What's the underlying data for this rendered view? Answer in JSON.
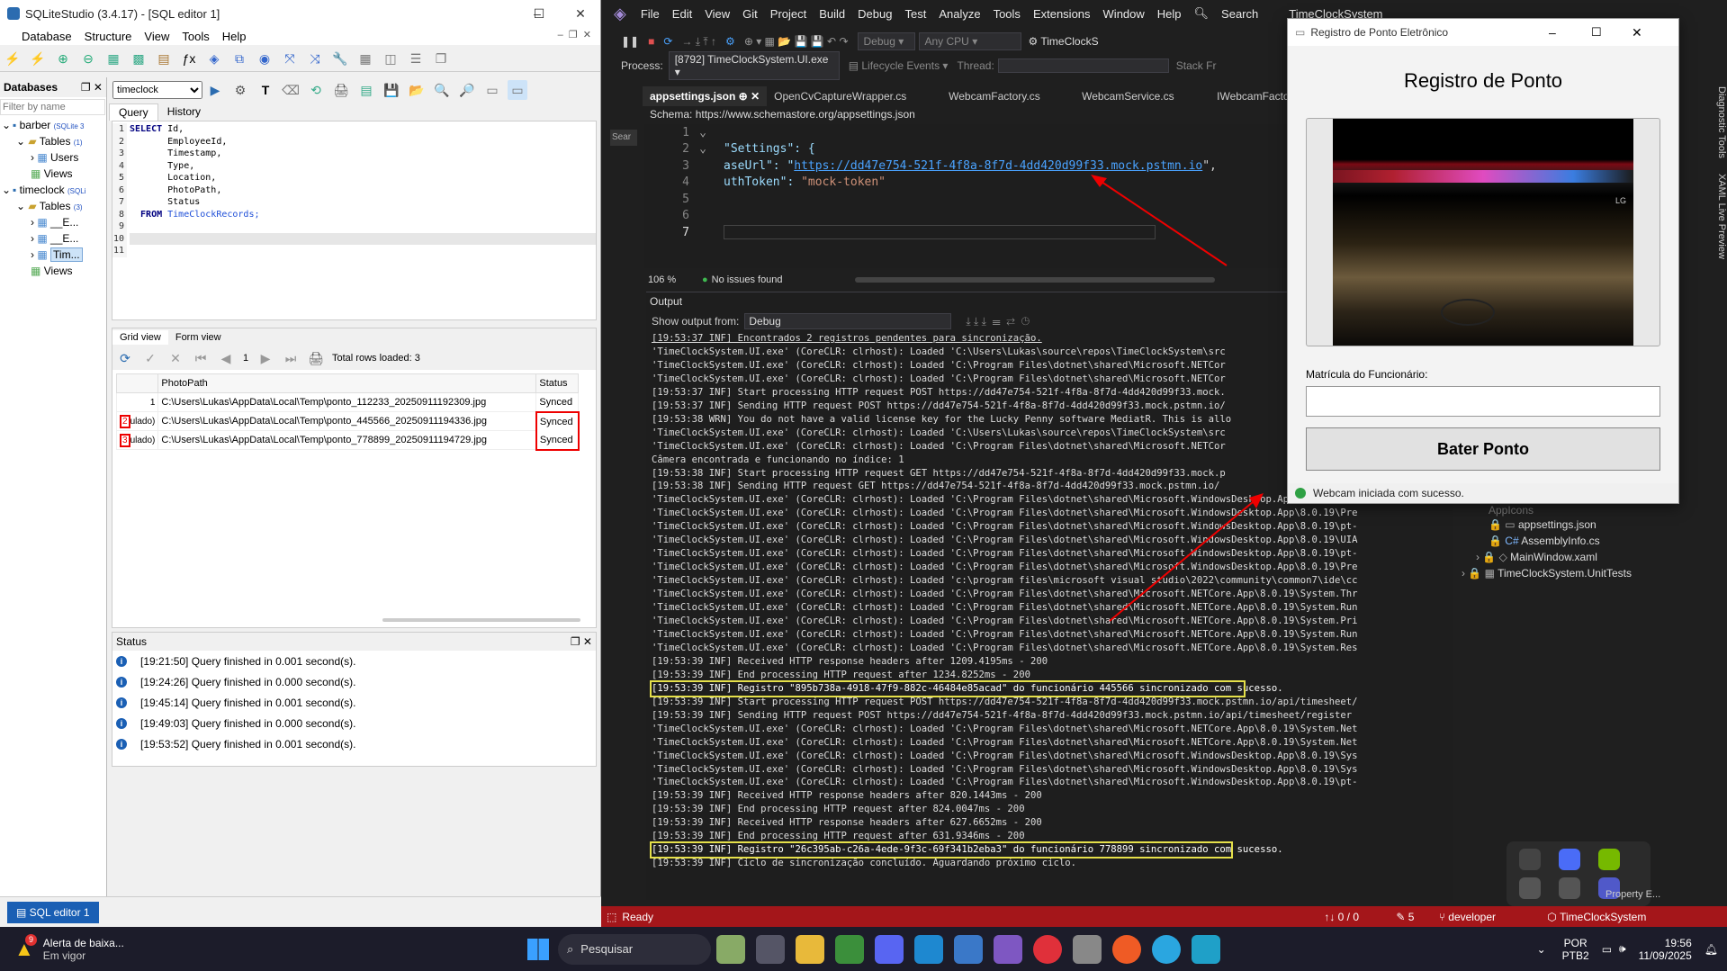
{
  "sqlite": {
    "title": "SQLiteStudio (3.4.17) - [SQL editor 1]",
    "menu": [
      "Database",
      "Structure",
      "View",
      "Tools",
      "Help"
    ],
    "db_panel_title": "Databases",
    "filter_placeholder": "Filter by name",
    "tree": [
      {
        "label": "barber",
        "tag": "(SQLite 3"
      },
      {
        "label": "Tables",
        "tag": "(1)"
      },
      {
        "label": "Users",
        "tag": ""
      },
      {
        "label": "Views",
        "tag": ""
      },
      {
        "label": "timeclock",
        "tag": "(SQLi"
      },
      {
        "label": "Tables",
        "tag": "(3)"
      },
      {
        "label": "__E...",
        "tag": ""
      },
      {
        "label": "__E...",
        "tag": ""
      },
      {
        "label": "Tim...",
        "tag": ""
      },
      {
        "label": "Views",
        "tag": ""
      }
    ],
    "db_select": "timeclock",
    "tabs": [
      "Query",
      "History"
    ],
    "sql_lines": [
      {
        "n": "1",
        "kw": "SELECT",
        "rest": " Id,"
      },
      {
        "n": "2",
        "kw": "",
        "rest": "       EmployeeId,"
      },
      {
        "n": "3",
        "kw": "",
        "rest": "       Timestamp,"
      },
      {
        "n": "4",
        "kw": "",
        "rest": "       Type,"
      },
      {
        "n": "5",
        "kw": "",
        "rest": "       Location,"
      },
      {
        "n": "6",
        "kw": "",
        "rest": "       PhotoPath,"
      },
      {
        "n": "7",
        "kw": "",
        "rest": "       Status"
      },
      {
        "n": "8",
        "kw": "  FROM",
        "rest": " TimeClockRecords;"
      },
      {
        "n": "9",
        "kw": "",
        "rest": ""
      },
      {
        "n": "10",
        "kw": "",
        "rest": ""
      },
      {
        "n": "11",
        "kw": "",
        "rest": ""
      }
    ],
    "result_tabs": [
      "Grid view",
      "Form view"
    ],
    "page_num": "1",
    "total_rows": "Total rows loaded: 3",
    "columns": [
      "PhotoPath",
      "Status"
    ],
    "rows": [
      {
        "n": "1",
        "prefix": "",
        "path": "C:\\Users\\Lukas\\AppData\\Local\\Temp\\ponto_112233_20250911192309.jpg",
        "status": "Synced"
      },
      {
        "n": "2",
        "prefix": "ulado)",
        "path": "C:\\Users\\Lukas\\AppData\\Local\\Temp\\ponto_445566_20250911194336.jpg",
        "status": "Synced"
      },
      {
        "n": "3",
        "prefix": "ulado)",
        "path": "C:\\Users\\Lukas\\AppData\\Local\\Temp\\ponto_778899_20250911194729.jpg",
        "status": "Synced"
      }
    ],
    "status_title": "Status",
    "status_lines": [
      "[19:21:50] Query finished in 0.001 second(s).",
      "[19:24:26] Query finished in 0.000 second(s).",
      "[19:45:14] Query finished in 0.001 second(s).",
      "[19:49:03] Query finished in 0.000 second(s).",
      "[19:53:52] Query finished in 0.001 second(s)."
    ],
    "bottom_tab": "SQL editor 1"
  },
  "vs": {
    "menu": [
      "File",
      "Edit",
      "View",
      "Git",
      "Project",
      "Build",
      "Debug",
      "Test",
      "Analyze",
      "Tools",
      "Extensions",
      "Window",
      "Help"
    ],
    "search": "Search",
    "solution": "TimeClockSystem",
    "config": "Debug",
    "platform": "Any CPU",
    "process_label": "Process:",
    "process": "[8792] TimeClockSystem.UI.exe",
    "lifecycle": "Lifecycle Events",
    "thread": "Thread:",
    "stack": "Stack Fr",
    "run_target": "TimeClockS",
    "tabs": [
      "appsettings.json",
      "OpenCvCaptureWrapper.cs",
      "WebcamFactory.cs",
      "WebcamService.cs",
      "IWebcamFactor"
    ],
    "schema": "Schema: https://www.schemastore.org/appsettings.json",
    "code": [
      {
        "n": "1",
        "text": ""
      },
      {
        "n": "2",
        "text": "\"Settings\": {"
      },
      {
        "n": "3",
        "key": "aseUrl\": \"",
        "url": "https://dd47e754-521f-4f8a-8f7d-4dd420d99f33.mock.pstmn.io",
        "end": "\","
      },
      {
        "n": "4",
        "key": "uthToken\": ",
        "val": "\"mock-token\""
      },
      {
        "n": "5",
        "text": ""
      },
      {
        "n": "6",
        "text": ""
      },
      {
        "n": "7",
        "text": ""
      }
    ],
    "zoom": "106 %",
    "issues": "No issues found",
    "output_title": "Output",
    "show_output_label": "Show output from:",
    "show_output_value": "Debug",
    "output_lines": [
      "[19:53:37 INF] Encontrados 2 registros pendentes para sincronização.",
      "'TimeClockSystem.UI.exe' (CoreCLR: clrhost): Loaded 'C:\\Users\\Lukas\\source\\repos\\TimeClockSystem\\src",
      "'TimeClockSystem.UI.exe' (CoreCLR: clrhost): Loaded 'C:\\Program Files\\dotnet\\shared\\Microsoft.NETCor",
      "'TimeClockSystem.UI.exe' (CoreCLR: clrhost): Loaded 'C:\\Program Files\\dotnet\\shared\\Microsoft.NETCor",
      "[19:53:37 INF] Start processing HTTP request POST https://dd47e754-521f-4f8a-8f7d-4dd420d99f33.mock.",
      "[19:53:37 INF] Sending HTTP request POST https://dd47e754-521f-4f8a-8f7d-4dd420d99f33.mock.pstmn.io/",
      "[19:53:38 WRN] You do not have a valid license key for the Lucky Penny software MediatR. This is allo",
      "'TimeClockSystem.UI.exe' (CoreCLR: clrhost): Loaded 'C:\\Users\\Lukas\\source\\repos\\TimeClockSystem\\src",
      "'TimeClockSystem.UI.exe' (CoreCLR: clrhost): Loaded 'C:\\Program Files\\dotnet\\shared\\Microsoft.NETCor",
      "Câmera encontrada e funcionando no índice: 1",
      "[19:53:38 INF] Start processing HTTP request GET https://dd47e754-521f-4f8a-8f7d-4dd420d99f33.mock.p",
      "[19:53:38 INF] Sending HTTP request GET https://dd47e754-521f-4f8a-8f7d-4dd420d99f33.mock.pstmn.io/",
      "'TimeClockSystem.UI.exe' (CoreCLR: clrhost): Loaded 'C:\\Program Files\\dotnet\\shared\\Microsoft.WindowsDesktop.App\\8.0.19\\UIA",
      "'TimeClockSystem.UI.exe' (CoreCLR: clrhost): Loaded 'C:\\Program Files\\dotnet\\shared\\Microsoft.WindowsDesktop.App\\8.0.19\\Pre",
      "'TimeClockSystem.UI.exe' (CoreCLR: clrhost): Loaded 'C:\\Program Files\\dotnet\\shared\\Microsoft.WindowsDesktop.App\\8.0.19\\pt-",
      "'TimeClockSystem.UI.exe' (CoreCLR: clrhost): Loaded 'C:\\Program Files\\dotnet\\shared\\Microsoft.WindowsDesktop.App\\8.0.19\\UIA",
      "'TimeClockSystem.UI.exe' (CoreCLR: clrhost): Loaded 'C:\\Program Files\\dotnet\\shared\\Microsoft.WindowsDesktop.App\\8.0.19\\pt-",
      "'TimeClockSystem.UI.exe' (CoreCLR: clrhost): Loaded 'C:\\Program Files\\dotnet\\shared\\Microsoft.WindowsDesktop.App\\8.0.19\\Pre",
      "'TimeClockSystem.UI.exe' (CoreCLR: clrhost): Loaded 'c:\\program files\\microsoft visual studio\\2022\\community\\common7\\ide\\cc",
      "'TimeClockSystem.UI.exe' (CoreCLR: clrhost): Loaded 'C:\\Program Files\\dotnet\\shared\\Microsoft.NETCore.App\\8.0.19\\System.Thr",
      "'TimeClockSystem.UI.exe' (CoreCLR: clrhost): Loaded 'C:\\Program Files\\dotnet\\shared\\Microsoft.NETCore.App\\8.0.19\\System.Run",
      "'TimeClockSystem.UI.exe' (CoreCLR: clrhost): Loaded 'C:\\Program Files\\dotnet\\shared\\Microsoft.NETCore.App\\8.0.19\\System.Pri",
      "'TimeClockSystem.UI.exe' (CoreCLR: clrhost): Loaded 'C:\\Program Files\\dotnet\\shared\\Microsoft.NETCore.App\\8.0.19\\System.Run",
      "'TimeClockSystem.UI.exe' (CoreCLR: clrhost): Loaded 'C:\\Program Files\\dotnet\\shared\\Microsoft.NETCore.App\\8.0.19\\System.Res",
      "[19:53:39 INF] Received HTTP response headers after 1209.4195ms - 200",
      "[19:53:39 INF] End processing HTTP request after 1234.8252ms - 200",
      "[19:53:39 INF] Registro \"895b738a-4918-47f9-882c-46484e85acad\" do funcionário 445566 sincronizado com sucesso.",
      "[19:53:39 INF] Start processing HTTP request POST https://dd47e754-521f-4f8a-8f7d-4dd420d99f33.mock.pstmn.io/api/timesheet/",
      "[19:53:39 INF] Sending HTTP request POST https://dd47e754-521f-4f8a-8f7d-4dd420d99f33.mock.pstmn.io/api/timesheet/register",
      "'TimeClockSystem.UI.exe' (CoreCLR: clrhost): Loaded 'C:\\Program Files\\dotnet\\shared\\Microsoft.NETCore.App\\8.0.19\\System.Net",
      "'TimeClockSystem.UI.exe' (CoreCLR: clrhost): Loaded 'C:\\Program Files\\dotnet\\shared\\Microsoft.NETCore.App\\8.0.19\\System.Net",
      "'TimeClockSystem.UI.exe' (CoreCLR: clrhost): Loaded 'C:\\Program Files\\dotnet\\shared\\Microsoft.WindowsDesktop.App\\8.0.19\\Sys",
      "'TimeClockSystem.UI.exe' (CoreCLR: clrhost): Loaded 'C:\\Program Files\\dotnet\\shared\\Microsoft.WindowsDesktop.App\\8.0.19\\Sys",
      "'TimeClockSystem.UI.exe' (CoreCLR: clrhost): Loaded 'C:\\Program Files\\dotnet\\shared\\Microsoft.WindowsDesktop.App\\8.0.19\\pt-",
      "[19:53:39 INF] Received HTTP response headers after 820.1443ms - 200",
      "[19:53:39 INF] End processing HTTP request after 824.0047ms - 200",
      "[19:53:39 INF] Received HTTP response headers after 627.6652ms - 200",
      "[19:53:39 INF] End processing HTTP request after 631.9346ms - 200",
      "[19:53:39 INF] Registro \"26c395ab-c26a-4ede-9f3c-69f341b2eba3\" do funcionário 778899 sincronizado com sucesso.",
      "[19:53:39 INF] Ciclo de sincronização concluído. Aguardando próximo ciclo."
    ],
    "solution_items": [
      "appsettings.json",
      "AssemblyInfo.cs",
      "MainWindow.xaml",
      "TimeClockSystem.UnitTests"
    ],
    "solution_item_partial": "AppIcons",
    "side_tabs": [
      "Diagnostic Tools",
      "XAML Live Preview"
    ],
    "status_ready": "Ready",
    "status_counts": "↑↓ 0 / 0",
    "status_edits": "5",
    "status_branch": "developer",
    "status_repo": "TimeClockSystem",
    "property": "Property E..."
  },
  "registro": {
    "title": "Registro de Ponto Eletrônico",
    "heading": "Registro de Ponto",
    "field_label": "Matrícula do Funcionário:",
    "field_value": "",
    "button": "Bater Ponto",
    "status": "Webcam iniciada com sucesso.",
    "status_color": "#2ea043",
    "webcam_caption": "LG"
  },
  "taskbar": {
    "alert_title": "Alerta de baixa...",
    "alert_sub": "Em vigor",
    "alert_badge": "9",
    "search": "Pesquisar",
    "lang1": "POR",
    "lang2": "PTB2",
    "time": "19:56",
    "date": "11/09/2025"
  }
}
